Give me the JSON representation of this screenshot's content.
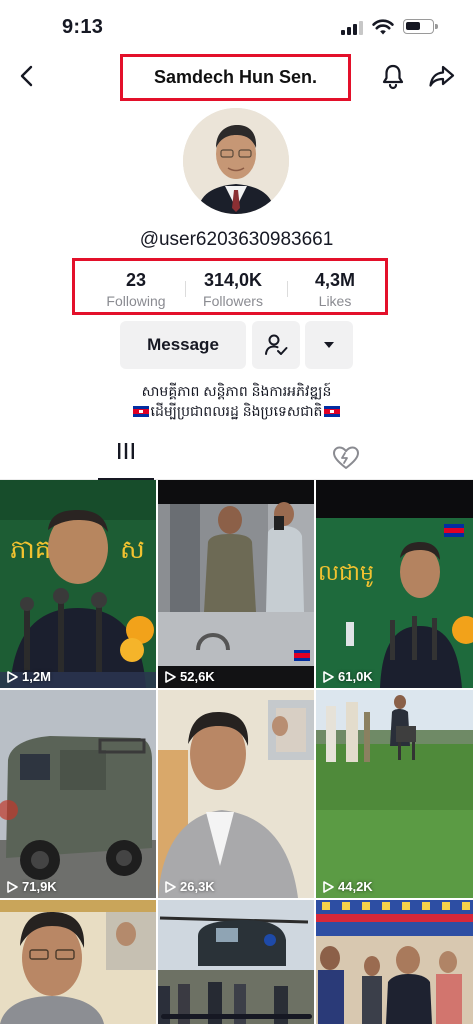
{
  "status_bar": {
    "time": "9:13",
    "battery_level": 0.6
  },
  "header": {
    "title": "Samdech Hun Sen."
  },
  "profile": {
    "username": "@user6203630983661",
    "stats": [
      {
        "value": "23",
        "label": "Following"
      },
      {
        "value": "314,0K",
        "label": "Followers"
      },
      {
        "value": "4,3M",
        "label": "Likes"
      }
    ],
    "bio_line1": "សាមគ្គីភាព សន្តិភាព និងការអភិវឌ្ឍន៍",
    "bio_line2": "ដើម្បីប្រជាពលរដ្ឋ និងប្រទេសជាតិ"
  },
  "actions": {
    "message_label": "Message"
  },
  "tabs": [
    {
      "name": "videos",
      "icon": "grid-icon",
      "active": true
    },
    {
      "name": "liked",
      "icon": "liked-heart-icon",
      "active": false
    }
  ],
  "videos": [
    {
      "views": "1,2M"
    },
    {
      "views": "52,6K"
    },
    {
      "views": "61,0K"
    },
    {
      "views": "71,9K"
    },
    {
      "views": "26,3K"
    },
    {
      "views": "44,2K"
    },
    {
      "views": ""
    },
    {
      "views": ""
    },
    {
      "views": ""
    }
  ],
  "colors": {
    "highlight": "#e3102a",
    "text": "#161823",
    "muted": "#8a8b91",
    "button_bg": "#f1f1f2"
  }
}
